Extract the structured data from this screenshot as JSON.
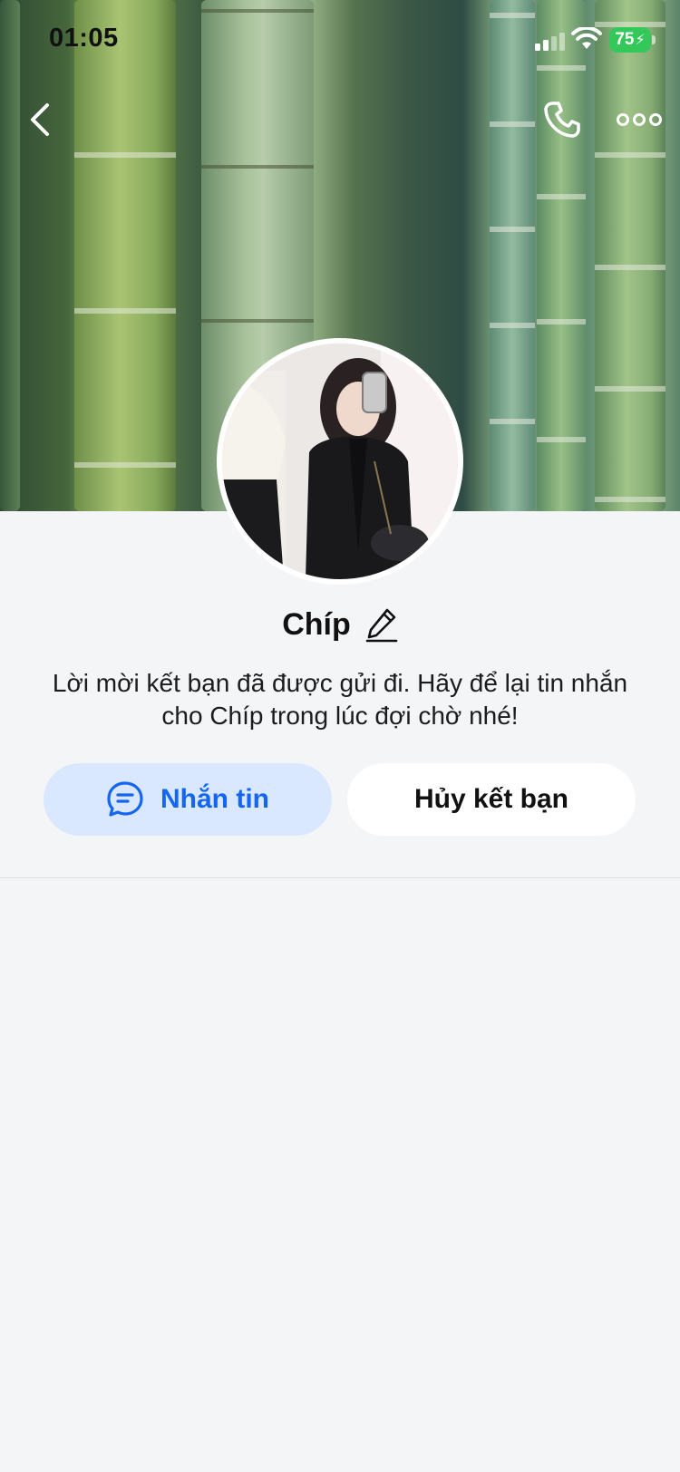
{
  "status_bar": {
    "time": "01:05",
    "battery_level": "75",
    "icons": [
      "signal-icon",
      "wifi-icon",
      "battery-icon"
    ]
  },
  "nav": {
    "icons": [
      "chevron-left-icon",
      "phone-icon",
      "more-icon"
    ]
  },
  "profile": {
    "name": "Chíp",
    "edit_icon": "pencil-icon",
    "info_text": "Lời mời kết bạn đã được gửi đi. Hãy để lại tin nhắn cho Chíp trong lúc đợi chờ nhé!"
  },
  "actions": {
    "message_label": "Nhắn tin",
    "message_icon": "chat-bubble-icon",
    "unfriend_label": "Hủy kết bạn"
  },
  "colors": {
    "accent": "#1466f0",
    "accent_bg": "#d9e8fe",
    "battery": "#34c759",
    "page_bg": "#f4f5f7"
  }
}
